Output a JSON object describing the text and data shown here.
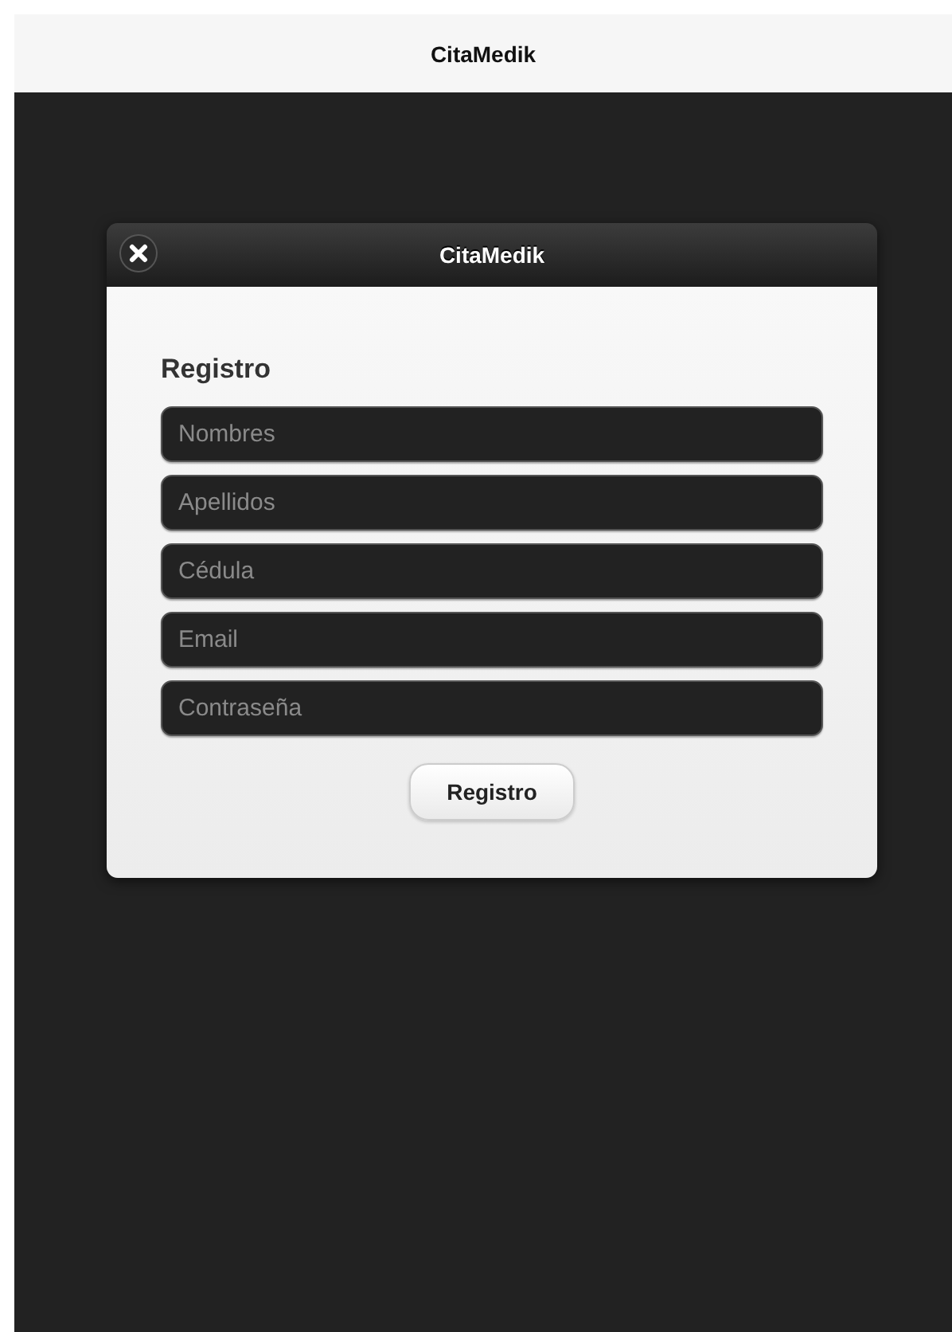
{
  "header": {
    "title": "CitaMedik"
  },
  "dialog": {
    "title": "CitaMedik",
    "heading": "Registro",
    "fields": [
      {
        "placeholder": "Nombres"
      },
      {
        "placeholder": "Apellidos"
      },
      {
        "placeholder": "Cédula"
      },
      {
        "placeholder": "Email"
      },
      {
        "placeholder": "Contraseña"
      }
    ],
    "button": "Registro"
  }
}
